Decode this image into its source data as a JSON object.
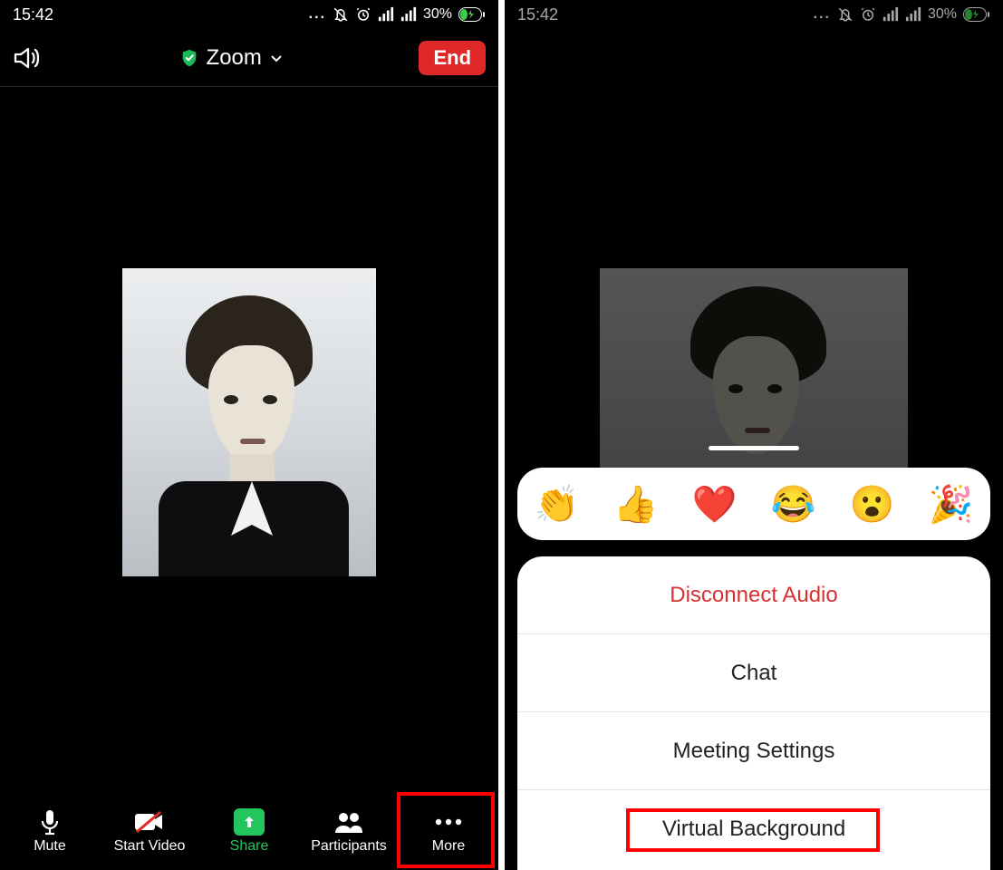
{
  "statusbar": {
    "time": "15:42",
    "dots": "...",
    "battery_pct": "30%"
  },
  "header": {
    "title": "Zoom",
    "end": "End"
  },
  "toolbar": {
    "mute": "Mute",
    "start_video": "Start Video",
    "share": "Share",
    "participants": "Participants",
    "more": "More"
  },
  "reactions": {
    "clap": "👏",
    "thumbs": "👍",
    "heart": "❤️",
    "joy": "😂",
    "wow": "😮",
    "party": "🎉"
  },
  "sheet": {
    "disconnect": "Disconnect Audio",
    "chat": "Chat",
    "settings": "Meeting Settings",
    "vbg": "Virtual Background"
  }
}
